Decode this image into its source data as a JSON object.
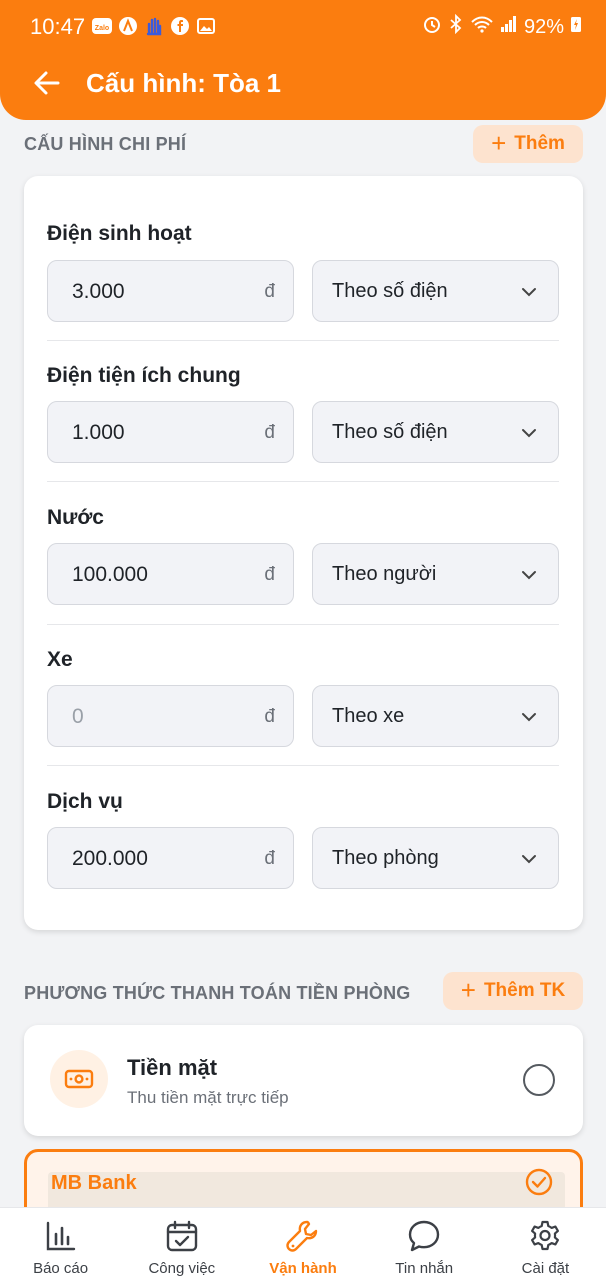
{
  "status_bar": {
    "time": "10:47",
    "battery": "92%"
  },
  "header": {
    "title": "Cấu hình: Tòa 1"
  },
  "cost_section": {
    "title": "CẤU HÌNH CHI PHÍ",
    "add_label": "Thêm"
  },
  "costs": [
    {
      "label": "Điện sinh hoạt",
      "amount": "3.000",
      "unit": "đ",
      "method": "Theo số điện"
    },
    {
      "label": "Điện tiện ích chung",
      "amount": "1.000",
      "unit": "đ",
      "method": "Theo số điện"
    },
    {
      "label": "Nước",
      "amount": "100.000",
      "unit": "đ",
      "method": "Theo người"
    },
    {
      "label": "Xe",
      "placeholder": "0",
      "unit": "đ",
      "method": "Theo xe"
    },
    {
      "label": "Dịch vụ",
      "amount": "200.000",
      "unit": "đ",
      "method": "Theo phòng"
    }
  ],
  "payment_section": {
    "title": "PHƯƠNG THỨC THANH TOÁN TIỀN PHÒNG",
    "add_label": "Thêm TK"
  },
  "payments": [
    {
      "name": "Tiền mặt",
      "description": "Thu tiền mặt trực tiếp",
      "selected": false
    },
    {
      "name": "MB Bank",
      "selected": true
    }
  ],
  "bottom_nav": [
    {
      "label": "Báo cáo",
      "icon": "bar-chart-icon"
    },
    {
      "label": "Công việc",
      "icon": "calendar-check-icon"
    },
    {
      "label": "Vận hành",
      "icon": "wrench-icon",
      "active": true
    },
    {
      "label": "Tin nhắn",
      "icon": "chat-bubble-icon"
    },
    {
      "label": "Cài đặt",
      "icon": "gear-icon"
    }
  ],
  "colors": {
    "accent": "#fb7d0f",
    "accent_light": "#fde3cf",
    "background": "#f2f3f5"
  }
}
